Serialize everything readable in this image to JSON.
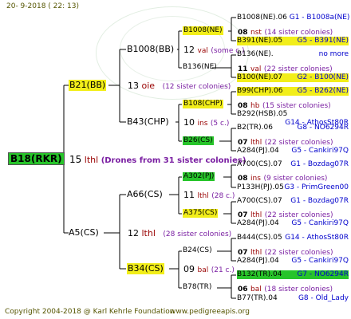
{
  "header": {
    "date": "20-  9-2018 (  22:  13)"
  },
  "footer": {
    "copyright": "Copyright 2004-2018 @ Karl Kehrle Foundation",
    "site": "www.pedigreeapis.org"
  },
  "root": {
    "id": "B18(RKR)",
    "gen": "15",
    "breed": "lthl",
    "note": "(Drones from 31 sister colonies)"
  },
  "l1_top": {
    "id": "B21(BB)",
    "gen": "13",
    "breed": "oie",
    "note": "(12 sister colonies)"
  },
  "l1_bot": {
    "id": "A5(CS)",
    "gen": "12",
    "breed": "lthl",
    "note": "(28 sister colonies)"
  },
  "l2": {
    "b1008bb": {
      "id": "B1008(BB)",
      "gen": "12",
      "breed": "val",
      "note": "(some c.)"
    },
    "b43chp": {
      "id": "B43(CHP)",
      "gen": "10",
      "breed": "ins",
      "note": "(5 c.)"
    },
    "a66cs": {
      "id": "A66(CS)",
      "gen": "11",
      "breed": "lthl",
      "note": "(28 c.)"
    },
    "b34cs": {
      "id": "B34(CS)",
      "gen": "09",
      "breed": "bal",
      "note": "(21 c.)"
    }
  },
  "l3": {
    "b1008ne": {
      "id": "B1008(NE)",
      "gen": "08",
      "breed": "nst",
      "note": "(14 sister colonies)"
    },
    "b136ne": {
      "id": "B136(NE)",
      "gen": "11",
      "breed": "val",
      "note": "(22 sister colonies)"
    },
    "b108chp": {
      "id": "B108(CHP)",
      "gen": "08",
      "breed": "hb",
      "note": "(15 sister colonies)"
    },
    "b26cs": {
      "id": "B26(CS)",
      "gen": "07",
      "breed": "lthl",
      "note": "(22 sister colonies)"
    },
    "a302pj": {
      "id": "A302(PJ)",
      "gen": "08",
      "breed": "ins",
      "note": "(9 sister colonies)"
    },
    "a375cs": {
      "id": "A375(CS)",
      "gen": "07",
      "breed": "lthl",
      "note": "(22 sister colonies)"
    },
    "b24cs": {
      "id": "B24(CS)",
      "gen": "07",
      "breed": "lthl",
      "note": "(22 sister colonies)"
    },
    "b78tr": {
      "id": "B78(TR)",
      "gen": "06",
      "breed": "bal",
      "note": "(18 sister colonies)"
    }
  },
  "l4": [
    {
      "a": "B1008(NE).06",
      "b": "G1 - B1008a(NE)"
    },
    {
      "a": "B391(NE).05",
      "b": "G5 - B391(NE)"
    },
    {
      "a": "B136(NE).",
      "b": "no more"
    },
    {
      "a": "B100(NE).07",
      "b": "G2 - B100(NE)"
    },
    {
      "a": "B99(CHP).06",
      "b": "G5 - B262(NE)"
    },
    {
      "a": "B292(HSB).05",
      "b": "G14 - AthosSt80R"
    },
    {
      "a": "B2(TR).06",
      "b": "G8 - NO6294R"
    },
    {
      "a": "A284(PJ).04",
      "b": "G5 - Cankiri97Q"
    },
    {
      "a": "A700(CS).07",
      "b": "G1 - Bozdag07R"
    },
    {
      "a": "P133H(PJ).05",
      "b": "G3 - PrimGreen00"
    },
    {
      "a": "A700(CS).07",
      "b": "G1 - Bozdag07R"
    },
    {
      "a": "A284(PJ).04",
      "b": "G5 - Cankiri97Q"
    },
    {
      "a": "B444(CS).05",
      "b": "G14 - AthosSt80R"
    },
    {
      "a": "A284(PJ).04",
      "b": "G5 - Cankiri97Q"
    },
    {
      "a": "B132(TR).04",
      "b": "G7 - NO6294R"
    },
    {
      "a": "B77(TR).04",
      "b": "G8 - Old_Lady"
    }
  ]
}
